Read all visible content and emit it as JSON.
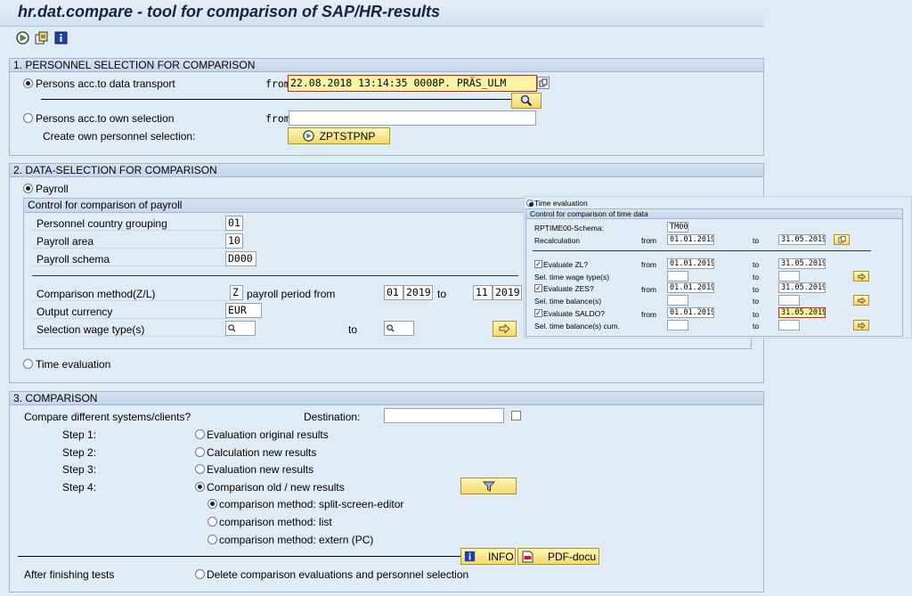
{
  "title": "hr.dat.compare - tool for comparison of SAP/HR-results",
  "toolbar": {
    "icons": [
      "execute-icon",
      "variant-icon",
      "info-icon"
    ]
  },
  "s1": {
    "header": "1. PERSONNEL SELECTION FOR COMPARISON",
    "opt_transport": "Persons acc.to data transport",
    "from1": "from",
    "transport_value": "22.08.2018 13:14:35  0008P. PRÄS_ULM",
    "opt_own": "Persons acc.to own selection",
    "from2": "from",
    "own_value": "",
    "create_label": "Create own personnel selection:",
    "create_btn": "ZPTSTPNP"
  },
  "s2": {
    "header": "2. DATA-SELECTION FOR COMPARISON",
    "opt_payroll": "Payroll",
    "ctrl_header": "Control for comparison of payroll",
    "pcg_label": "Personnel country grouping",
    "pcg_value": "01",
    "area_label": "Payroll area",
    "area_value": "10",
    "schema_label": "Payroll schema",
    "schema_value": "D000",
    "method_label": "Comparison method(Z/L)",
    "method_value": "Z",
    "period_label": "payroll period  from",
    "period_from_m": "01",
    "period_from_y": "2019",
    "to1": "to",
    "period_to_m": "11",
    "period_to_y": "2019",
    "currency_label": "Output currency",
    "currency_value": "EUR",
    "wage_label": "Selection wage type(s)",
    "to2": "to",
    "opt_time": "Time evaluation"
  },
  "overlay": {
    "opt_time": "Time evaluation",
    "ctrl_header": "Control for comparison of time data",
    "schema_label": "RPTIME00-Schema:",
    "schema_value": "TM00",
    "recalc_label": "Recalculation",
    "from": "from",
    "to": "to",
    "recalc_from": "01.01.2019",
    "recalc_to": "31.05.2019",
    "zl_label": "Evaluate ZL?",
    "zl_from": "01.01.2019",
    "zl_to": "31.05.2019",
    "sel_wage_label": "Sel. time wage type(s)",
    "zes_label": "Evaluate ZES?",
    "zes_from": "01.01.2019",
    "zes_to": "31.05.2019",
    "sel_bal_label": "Sel. time balance(s)",
    "saldo_label": "Evaluate SALDO?",
    "saldo_from": "01.01.2019",
    "saldo_to": "31.05.2019",
    "sel_bal_cum_label": "Sel. time balance(s) cum."
  },
  "s3": {
    "header": "3. COMPARISON",
    "compare_label": "Compare different systems/clients?",
    "dest_label": "Destination:",
    "dest_value": "",
    "step1": "Step 1:",
    "step1_opt": "Evaluation original results",
    "step2": "Step 2:",
    "step2_opt": "Calculation new results",
    "step3": "Step 3:",
    "step3_opt": "Evaluation new results",
    "step4": "Step 4:",
    "step4_opt": "Comparison old / new results",
    "m1": "comparison method: split-screen-editor",
    "m2": "comparison method: list",
    "m3": "comparison method: extern (PC)",
    "info_btn": "INFO",
    "pdf_btn": "PDF-docu",
    "after_label": "After finishing tests",
    "delete_opt": "Delete comparison evaluations and personnel selection"
  }
}
